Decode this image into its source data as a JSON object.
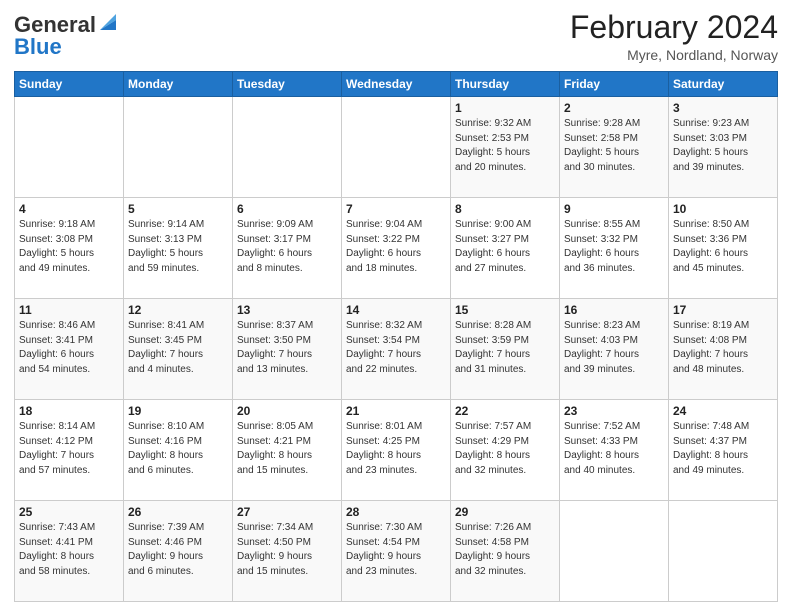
{
  "header": {
    "logo_general": "General",
    "logo_blue": "Blue",
    "main_title": "February 2024",
    "sub_title": "Myre, Nordland, Norway"
  },
  "calendar": {
    "days_of_week": [
      "Sunday",
      "Monday",
      "Tuesday",
      "Wednesday",
      "Thursday",
      "Friday",
      "Saturday"
    ],
    "weeks": [
      [
        {
          "num": "",
          "detail": ""
        },
        {
          "num": "",
          "detail": ""
        },
        {
          "num": "",
          "detail": ""
        },
        {
          "num": "",
          "detail": ""
        },
        {
          "num": "1",
          "detail": "Sunrise: 9:32 AM\nSunset: 2:53 PM\nDaylight: 5 hours\nand 20 minutes."
        },
        {
          "num": "2",
          "detail": "Sunrise: 9:28 AM\nSunset: 2:58 PM\nDaylight: 5 hours\nand 30 minutes."
        },
        {
          "num": "3",
          "detail": "Sunrise: 9:23 AM\nSunset: 3:03 PM\nDaylight: 5 hours\nand 39 minutes."
        }
      ],
      [
        {
          "num": "4",
          "detail": "Sunrise: 9:18 AM\nSunset: 3:08 PM\nDaylight: 5 hours\nand 49 minutes."
        },
        {
          "num": "5",
          "detail": "Sunrise: 9:14 AM\nSunset: 3:13 PM\nDaylight: 5 hours\nand 59 minutes."
        },
        {
          "num": "6",
          "detail": "Sunrise: 9:09 AM\nSunset: 3:17 PM\nDaylight: 6 hours\nand 8 minutes."
        },
        {
          "num": "7",
          "detail": "Sunrise: 9:04 AM\nSunset: 3:22 PM\nDaylight: 6 hours\nand 18 minutes."
        },
        {
          "num": "8",
          "detail": "Sunrise: 9:00 AM\nSunset: 3:27 PM\nDaylight: 6 hours\nand 27 minutes."
        },
        {
          "num": "9",
          "detail": "Sunrise: 8:55 AM\nSunset: 3:32 PM\nDaylight: 6 hours\nand 36 minutes."
        },
        {
          "num": "10",
          "detail": "Sunrise: 8:50 AM\nSunset: 3:36 PM\nDaylight: 6 hours\nand 45 minutes."
        }
      ],
      [
        {
          "num": "11",
          "detail": "Sunrise: 8:46 AM\nSunset: 3:41 PM\nDaylight: 6 hours\nand 54 minutes."
        },
        {
          "num": "12",
          "detail": "Sunrise: 8:41 AM\nSunset: 3:45 PM\nDaylight: 7 hours\nand 4 minutes."
        },
        {
          "num": "13",
          "detail": "Sunrise: 8:37 AM\nSunset: 3:50 PM\nDaylight: 7 hours\nand 13 minutes."
        },
        {
          "num": "14",
          "detail": "Sunrise: 8:32 AM\nSunset: 3:54 PM\nDaylight: 7 hours\nand 22 minutes."
        },
        {
          "num": "15",
          "detail": "Sunrise: 8:28 AM\nSunset: 3:59 PM\nDaylight: 7 hours\nand 31 minutes."
        },
        {
          "num": "16",
          "detail": "Sunrise: 8:23 AM\nSunset: 4:03 PM\nDaylight: 7 hours\nand 39 minutes."
        },
        {
          "num": "17",
          "detail": "Sunrise: 8:19 AM\nSunset: 4:08 PM\nDaylight: 7 hours\nand 48 minutes."
        }
      ],
      [
        {
          "num": "18",
          "detail": "Sunrise: 8:14 AM\nSunset: 4:12 PM\nDaylight: 7 hours\nand 57 minutes."
        },
        {
          "num": "19",
          "detail": "Sunrise: 8:10 AM\nSunset: 4:16 PM\nDaylight: 8 hours\nand 6 minutes."
        },
        {
          "num": "20",
          "detail": "Sunrise: 8:05 AM\nSunset: 4:21 PM\nDaylight: 8 hours\nand 15 minutes."
        },
        {
          "num": "21",
          "detail": "Sunrise: 8:01 AM\nSunset: 4:25 PM\nDaylight: 8 hours\nand 23 minutes."
        },
        {
          "num": "22",
          "detail": "Sunrise: 7:57 AM\nSunset: 4:29 PM\nDaylight: 8 hours\nand 32 minutes."
        },
        {
          "num": "23",
          "detail": "Sunrise: 7:52 AM\nSunset: 4:33 PM\nDaylight: 8 hours\nand 40 minutes."
        },
        {
          "num": "24",
          "detail": "Sunrise: 7:48 AM\nSunset: 4:37 PM\nDaylight: 8 hours\nand 49 minutes."
        }
      ],
      [
        {
          "num": "25",
          "detail": "Sunrise: 7:43 AM\nSunset: 4:41 PM\nDaylight: 8 hours\nand 58 minutes."
        },
        {
          "num": "26",
          "detail": "Sunrise: 7:39 AM\nSunset: 4:46 PM\nDaylight: 9 hours\nand 6 minutes."
        },
        {
          "num": "27",
          "detail": "Sunrise: 7:34 AM\nSunset: 4:50 PM\nDaylight: 9 hours\nand 15 minutes."
        },
        {
          "num": "28",
          "detail": "Sunrise: 7:30 AM\nSunset: 4:54 PM\nDaylight: 9 hours\nand 23 minutes."
        },
        {
          "num": "29",
          "detail": "Sunrise: 7:26 AM\nSunset: 4:58 PM\nDaylight: 9 hours\nand 32 minutes."
        },
        {
          "num": "",
          "detail": ""
        },
        {
          "num": "",
          "detail": ""
        }
      ]
    ]
  }
}
